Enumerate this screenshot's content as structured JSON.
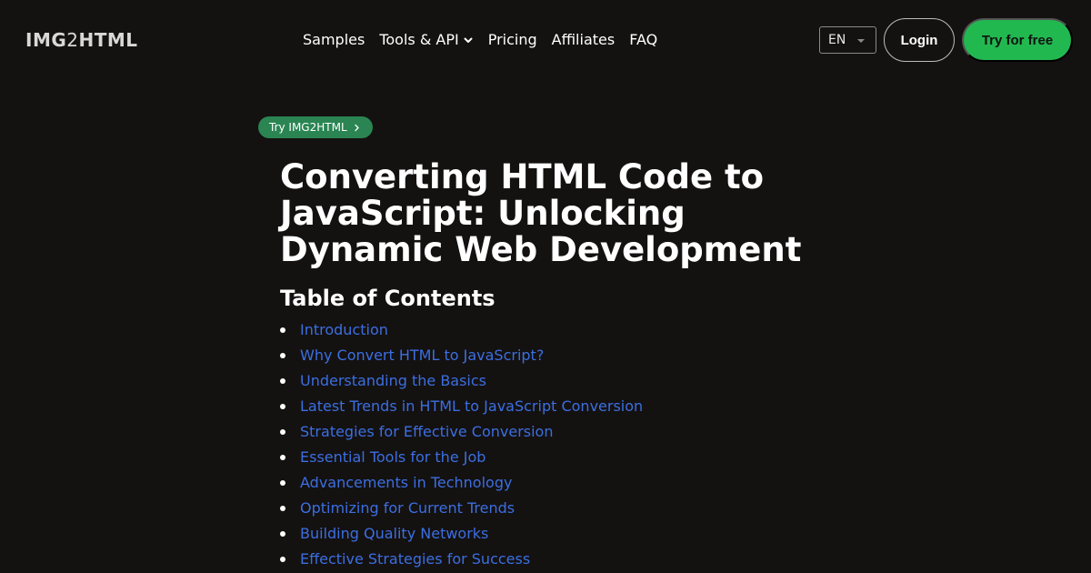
{
  "header": {
    "logo": {
      "part1": "IMG",
      "part2": "2",
      "part3": "HTML"
    },
    "nav": [
      {
        "label": "Samples",
        "has_dropdown": false
      },
      {
        "label": "Tools & API",
        "has_dropdown": true
      },
      {
        "label": "Pricing",
        "has_dropdown": false
      },
      {
        "label": "Affiliates",
        "has_dropdown": false
      },
      {
        "label": "FAQ",
        "has_dropdown": false
      }
    ],
    "language": "EN",
    "login_label": "Login",
    "cta_label": "Try for free"
  },
  "main": {
    "pill_label": "Try IMG2HTML",
    "title": "Converting HTML Code to JavaScript: Unlocking Dynamic Web Development",
    "toc_heading": "Table of Contents",
    "toc_items": [
      "Introduction",
      "Why Convert HTML to JavaScript?",
      "Understanding the Basics",
      "Latest Trends in HTML to JavaScript Conversion",
      "Strategies for Effective Conversion",
      "Essential Tools for the Job",
      "Advancements in Technology",
      "Optimizing for Current Trends",
      "Building Quality Networks",
      "Effective Strategies for Success"
    ]
  },
  "colors": {
    "background": "#141111",
    "cta_green": "#22b850",
    "pill_green": "#2a8552",
    "link_blue": "#3b6fe0"
  },
  "icons": {
    "nav_dropdown": "chevron-down-icon",
    "pill": "chevron-right-icon",
    "language": "caret-down-icon",
    "toc_bullet": "bullet-dot"
  }
}
